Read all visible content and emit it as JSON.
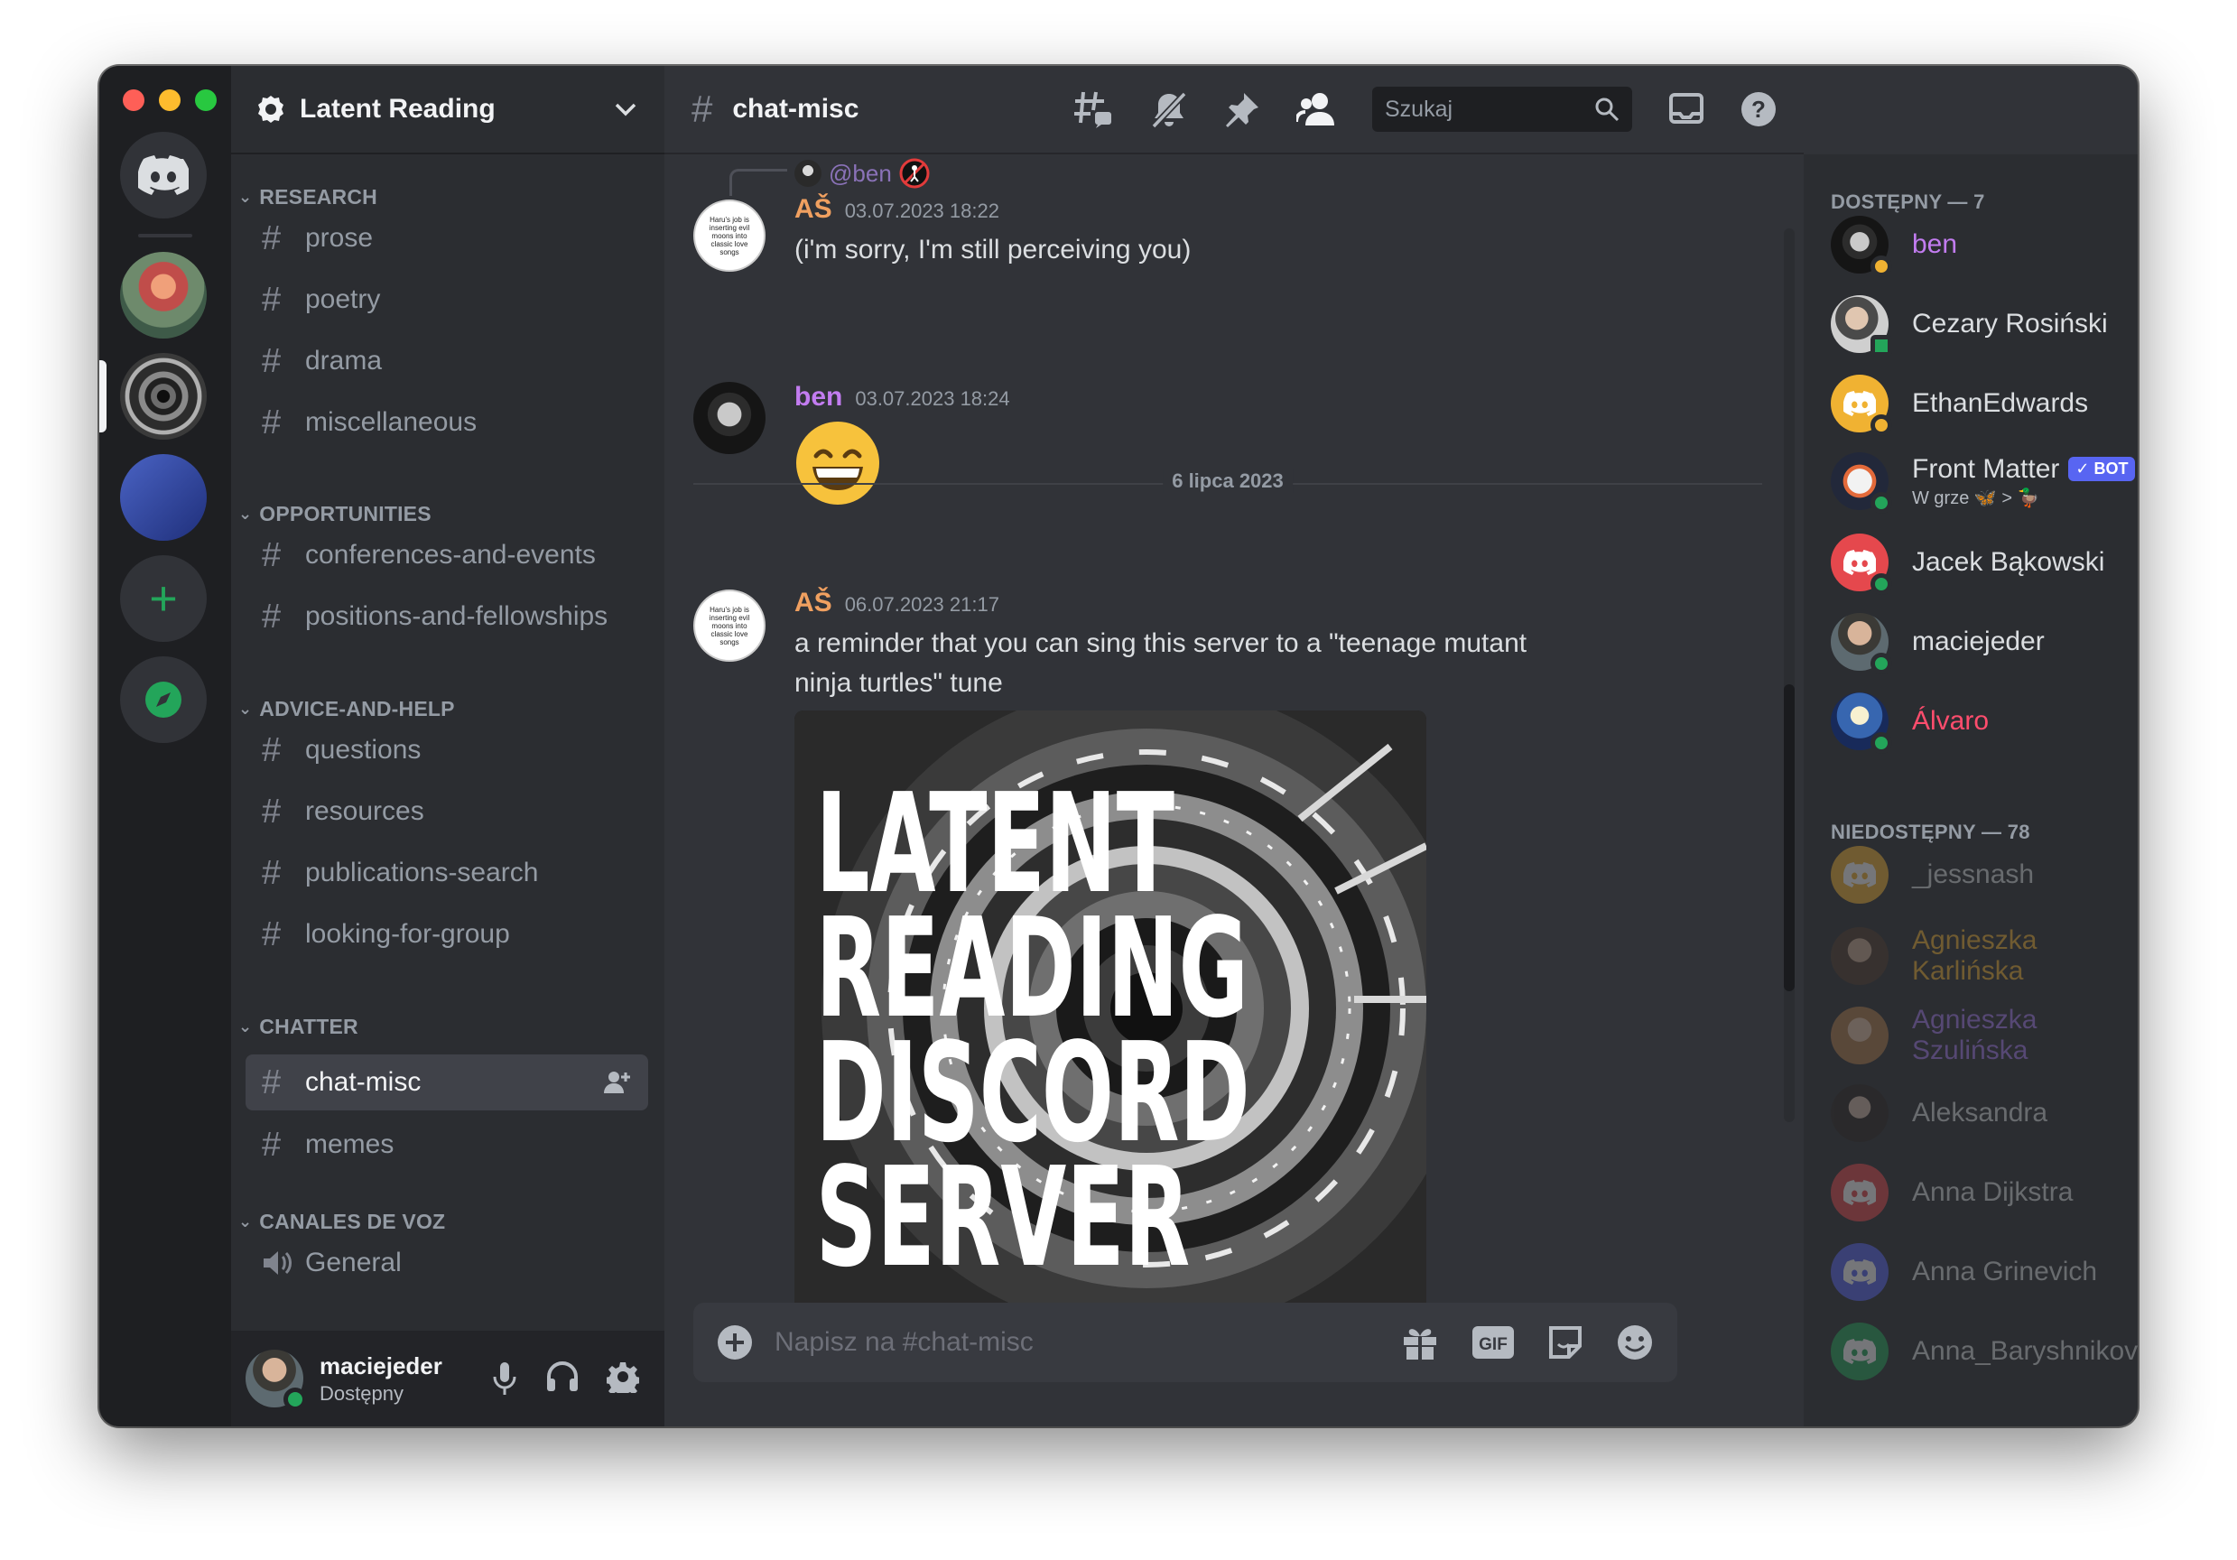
{
  "server": {
    "name": "Latent Reading"
  },
  "categories": {
    "research": "RESEARCH",
    "opportunities": "OPPORTUNITIES",
    "advice": "ADVICE-AND-HELP",
    "chatter": "CHATTER",
    "voice": "CANALES DE VOZ"
  },
  "channels": {
    "prose": "prose",
    "poetry": "poetry",
    "drama": "drama",
    "misc": "miscellaneous",
    "conf": "conferences-and-events",
    "positions": "positions-and-fellowships",
    "questions": "questions",
    "resources": "resources",
    "pubs": "publications-search",
    "lfg": "looking-for-group",
    "chat_misc": "chat-misc",
    "memes": "memes",
    "general": "General"
  },
  "user_panel": {
    "name": "maciejeder",
    "status": "Dostępny"
  },
  "header": {
    "channel": "chat-misc",
    "search_placeholder": "Szukaj"
  },
  "messages": {
    "reply_to": "@ben",
    "m1": {
      "author": "AŠ",
      "timestamp": "03.07.2023 18:22",
      "text": "(i'm sorry, I'm still perceiving you)"
    },
    "m2": {
      "author": "ben",
      "timestamp": "03.07.2023 18:24",
      "emoji": "😄"
    },
    "divider": "6 lipca 2023",
    "m3": {
      "author": "AŠ",
      "timestamp": "06.07.2023 21:17",
      "text": "a reminder that you can sing this server to a \"teenage mutant ninja turtles\" tune",
      "image_lines": [
        "LATENT",
        "READING",
        "DISCORD",
        "SERVER"
      ]
    },
    "avatar_text": "Haru's job is inserting evil moons into classic love songs"
  },
  "composer": {
    "placeholder": "Napisz na #chat-misc"
  },
  "members": {
    "online_header": "DOSTĘPNY — 7",
    "offline_header": "NIEDOSTĘPNY — 78",
    "online": [
      {
        "name": "ben",
        "color": "#c27cf0"
      },
      {
        "name": "Cezary Rosiński",
        "color": "#dbdee1"
      },
      {
        "name": "EthanEdwards",
        "color": "#dbdee1"
      },
      {
        "name": "Front Matter",
        "color": "#dbdee1",
        "tag": "✓ BOT",
        "status": "W grze 🦋 > 🦆"
      },
      {
        "name": "Jacek Bąkowski",
        "color": "#dbdee1"
      },
      {
        "name": "maciejeder",
        "color": "#dbdee1"
      },
      {
        "name": "Álvaro",
        "color": "#ff4d6d"
      }
    ],
    "offline": [
      {
        "name": "_jessnash",
        "color": "#dbdee1"
      },
      {
        "name": "Agnieszka Karlińska",
        "color": "#f0b232"
      },
      {
        "name": "Agnieszka Szulińska",
        "color": "#a67cf0"
      },
      {
        "name": "Aleksandra",
        "color": "#dbdee1"
      },
      {
        "name": "Anna Dijkstra",
        "color": "#dbdee1"
      },
      {
        "name": "Anna Grinevich",
        "color": "#dbdee1"
      },
      {
        "name": "Anna_Baryshnikova",
        "color": "#dbdee1"
      }
    ]
  },
  "colors": {
    "accent": "#5865f2",
    "online": "#23a55a",
    "idle": "#f0b232",
    "author_as": "#f0a060",
    "author_ben": "#c27cf0"
  }
}
